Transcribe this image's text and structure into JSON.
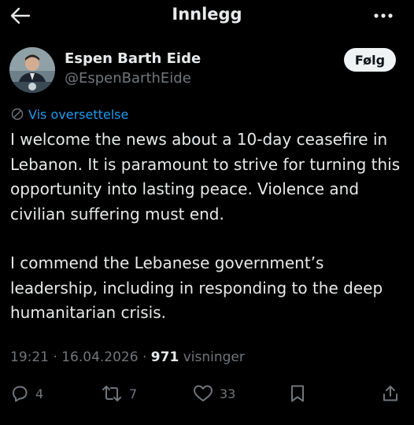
{
  "header": {
    "title": "Innlegg",
    "back_icon": "arrow-left-icon",
    "more_icon": "more-horizontal-icon"
  },
  "author": {
    "name": "Espen Barth Eide",
    "handle": "@EspenBarthEide",
    "avatar_icon": "profile-photo",
    "follow_label": "Følg"
  },
  "translate": {
    "label": "Vis oversettelse",
    "icon": "globe-icon"
  },
  "tweet": {
    "paragraph_1": "I welcome the news about a 10-day ceasefire in Lebanon. It is paramount to strive for turning this opportunity into lasting peace. Violence and civilian suffering must end.",
    "paragraph_2": "I commend the Lebanese government’s leadership, including in responding to the deep humanitarian crisis."
  },
  "meta": {
    "time": "19:21",
    "separator": "·",
    "date": "16.04.2026",
    "views_count": "971",
    "views_label": "visninger"
  },
  "actions": {
    "replies": "4",
    "reposts": "7",
    "likes": "33"
  },
  "colors": {
    "background": "#000000",
    "text": "#e7e9ea",
    "secondary": "#71767b",
    "link": "#1d9bf0",
    "follow_bg": "#eff3f4"
  }
}
